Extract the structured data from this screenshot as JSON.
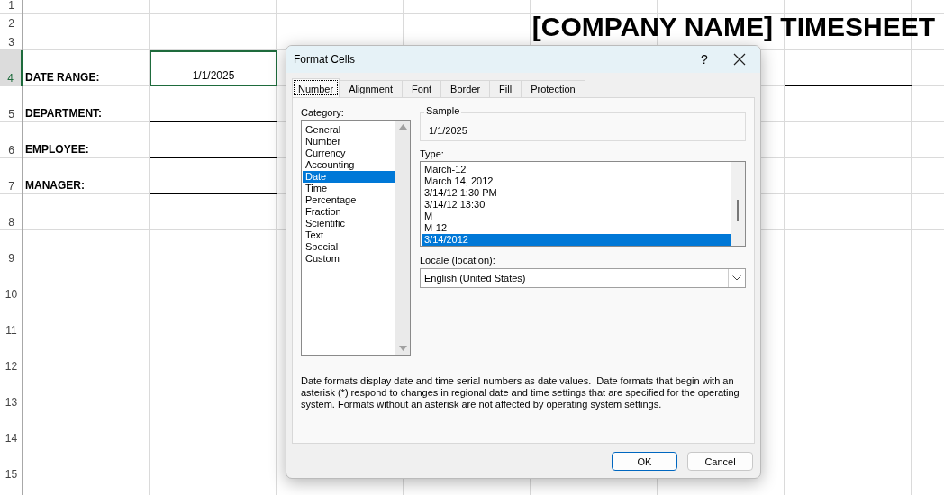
{
  "sheet": {
    "title": "[COMPANY NAME] TIMESHEET",
    "row_numbers": [
      "1",
      "2",
      "3",
      "4",
      "5",
      "6",
      "7",
      "8",
      "9",
      "10",
      "11",
      "12",
      "13",
      "14",
      "15"
    ],
    "fields": [
      {
        "label": "DATE RANGE:",
        "value": "1/1/2025",
        "selected": true
      },
      {
        "label": "DEPARTMENT:",
        "selected": false
      },
      {
        "label": "EMPLOYEE:",
        "selected": false
      },
      {
        "label": "MANAGER:",
        "selected": false
      }
    ]
  },
  "dialog": {
    "title": "Format Cells",
    "help": "?",
    "tabs": [
      {
        "label": "Number",
        "selected": true
      },
      {
        "label": "Alignment",
        "selected": false
      },
      {
        "label": "Font",
        "selected": false
      },
      {
        "label": "Border",
        "selected": false
      },
      {
        "label": "Fill",
        "selected": false
      },
      {
        "label": "Protection",
        "selected": false
      }
    ],
    "category": {
      "label": "Category:",
      "items": [
        {
          "label": "General",
          "selected": false
        },
        {
          "label": "Number",
          "selected": false
        },
        {
          "label": "Currency",
          "selected": false
        },
        {
          "label": "Accounting",
          "selected": false
        },
        {
          "label": "Date",
          "selected": true
        },
        {
          "label": "Time",
          "selected": false
        },
        {
          "label": "Percentage",
          "selected": false
        },
        {
          "label": "Fraction",
          "selected": false
        },
        {
          "label": "Scientific",
          "selected": false
        },
        {
          "label": "Text",
          "selected": false
        },
        {
          "label": "Special",
          "selected": false
        },
        {
          "label": "Custom",
          "selected": false
        }
      ]
    },
    "sample": {
      "label": "Sample",
      "value": "1/1/2025"
    },
    "type": {
      "label": "Type:",
      "items": [
        {
          "label": "March-12",
          "selected": false
        },
        {
          "label": "March 14, 2012",
          "selected": false
        },
        {
          "label": "3/14/12 1:30 PM",
          "selected": false
        },
        {
          "label": "3/14/12 13:30",
          "selected": false
        },
        {
          "label": "M",
          "selected": false
        },
        {
          "label": "M-12",
          "selected": false
        },
        {
          "label": "3/14/2012",
          "selected": true
        }
      ]
    },
    "locale": {
      "label": "Locale (location):",
      "value": "English (United States)"
    },
    "description": "Date formats display date and time serial numbers as date values.  Date formats that begin with an asterisk (*) respond to changes in regional date and time settings that are specified for the operating system. Formats without an asterisk are not affected by operating system settings.",
    "buttons": [
      {
        "label": "OK",
        "default": true
      },
      {
        "label": "Cancel",
        "default": false
      }
    ]
  }
}
